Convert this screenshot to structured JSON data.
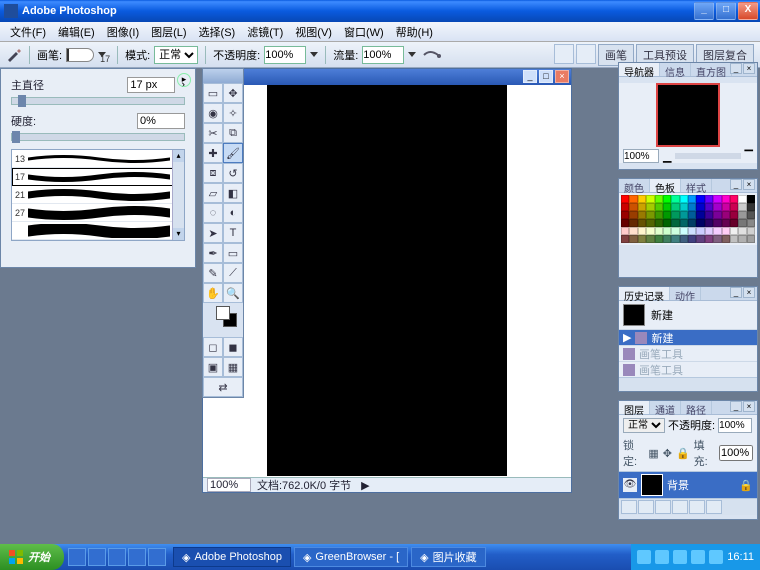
{
  "app": {
    "title": "Adobe Photoshop"
  },
  "window_controls": {
    "min": "_",
    "max": "□",
    "close": "X"
  },
  "menu": [
    "文件(F)",
    "编辑(E)",
    "图像(I)",
    "图层(L)",
    "选择(S)",
    "滤镜(T)",
    "视图(V)",
    "窗口(W)",
    "帮助(H)"
  ],
  "options": {
    "brush_label": "画笔:",
    "brush_size_ind": "17",
    "mode_label": "模式:",
    "mode_value": "正常",
    "opacity_label": "不透明度:",
    "opacity_value": "100%",
    "flow_label": "流量:",
    "flow_value": "100%",
    "tabs": [
      "画笔",
      "工具预设",
      "图层复合"
    ]
  },
  "brush_panel": {
    "diameter_label": "主直径",
    "diameter_value": "17 px",
    "hardness_label": "硬度:",
    "hardness_value": "0%",
    "presets": [
      {
        "size": "13",
        "sel": false
      },
      {
        "size": "17",
        "sel": true
      },
      {
        "size": "21",
        "sel": false
      },
      {
        "size": "27",
        "sel": false
      },
      {
        "size": "",
        "sel": false
      }
    ]
  },
  "document": {
    "zoom": "100%",
    "status": "文档:762.0K/0 字节"
  },
  "panels": {
    "navigator": {
      "tabs": [
        "导航器",
        "信息",
        "直方图"
      ],
      "zoom": "100%"
    },
    "swatches": {
      "tabs": [
        "颜色",
        "色板",
        "样式"
      ],
      "colors": [
        "#ff0000",
        "#ff6600",
        "#ffcc00",
        "#ccff00",
        "#66ff00",
        "#00ff00",
        "#00ff99",
        "#00ffff",
        "#0099ff",
        "#0000ff",
        "#6600ff",
        "#cc00ff",
        "#ff00cc",
        "#ff0066",
        "#ffffff",
        "#000000",
        "#cc0000",
        "#cc5200",
        "#cca300",
        "#a3cc00",
        "#52cc00",
        "#00cc00",
        "#00cc7a",
        "#00cccc",
        "#007acc",
        "#0000cc",
        "#5200cc",
        "#a300cc",
        "#cc00a3",
        "#cc0052",
        "#cccccc",
        "#333333",
        "#990000",
        "#993d00",
        "#997a00",
        "#7a9900",
        "#3d9900",
        "#009900",
        "#00995c",
        "#009999",
        "#005c99",
        "#000099",
        "#3d0099",
        "#7a0099",
        "#99007a",
        "#99003d",
        "#999999",
        "#555555",
        "#660000",
        "#662900",
        "#665200",
        "#526600",
        "#296600",
        "#006600",
        "#00663d",
        "#006666",
        "#003d66",
        "#000066",
        "#290066",
        "#520066",
        "#660052",
        "#660029",
        "#777777",
        "#888888",
        "#ffcccc",
        "#ffe0cc",
        "#fff5cc",
        "#f5ffcc",
        "#e0ffcc",
        "#ccffcc",
        "#ccffe0",
        "#ccffff",
        "#cce0ff",
        "#ccccff",
        "#e0ccff",
        "#f5ccff",
        "#ffccf5",
        "#f0f0f0",
        "#e0e0e0",
        "#d0d0d0",
        "#804040",
        "#806040",
        "#808040",
        "#608040",
        "#408040",
        "#408060",
        "#408080",
        "#406080",
        "#404080",
        "#604080",
        "#804080",
        "#806080",
        "#806060",
        "#c0c0c0",
        "#b0b0b0",
        "#a0a0a0"
      ]
    },
    "history": {
      "tabs": [
        "历史记录",
        "动作"
      ],
      "snapshot": "新建",
      "steps": [
        {
          "label": "新建",
          "sel": true
        },
        {
          "label": "画笔工具",
          "sel": false
        },
        {
          "label": "画笔工具",
          "sel": false
        }
      ]
    },
    "layers": {
      "tabs": [
        "图层",
        "通道",
        "路径"
      ],
      "blend": "正常",
      "opacity_label": "不透明度:",
      "opacity": "100%",
      "lock_label": "锁定:",
      "fill_label": "填充:",
      "fill": "100%",
      "layer_name": "背景"
    }
  },
  "taskbar": {
    "start": "开始",
    "buttons": [
      "Adobe Photoshop",
      "GreenBrowser - [",
      "图片收藏"
    ],
    "clock": "16:11"
  }
}
